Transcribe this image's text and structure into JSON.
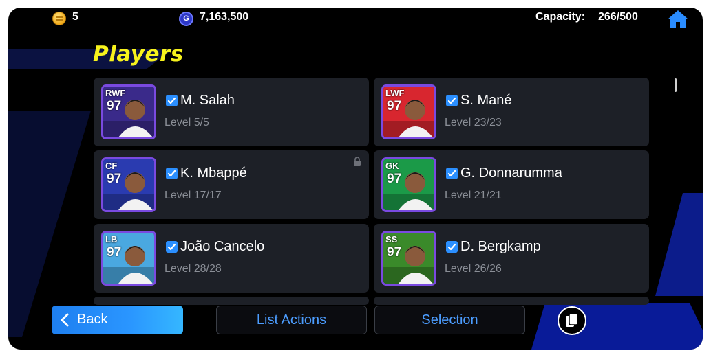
{
  "topbar": {
    "coins": "5",
    "gp_icon_letter": "G",
    "gp": "7,163,500",
    "capacity_label": "Capacity:",
    "capacity_value": "266/500"
  },
  "title": "Players",
  "players": [
    {
      "position": "RWF",
      "rating": "97",
      "name": "M. Salah",
      "level": "Level 5/5",
      "card_color": "#3a2a8a",
      "locked": false
    },
    {
      "position": "LWF",
      "rating": "97",
      "name": "S. Mané",
      "level": "Level 23/23",
      "card_color": "#d8262f",
      "locked": false
    },
    {
      "position": "CF",
      "rating": "97",
      "name": "K. Mbappé",
      "level": "Level 17/17",
      "card_color": "#2a3bb0",
      "locked": true
    },
    {
      "position": "GK",
      "rating": "97",
      "name": "G. Donnarumma",
      "level": "Level 21/21",
      "card_color": "#1b9a48",
      "locked": false
    },
    {
      "position": "LB",
      "rating": "97",
      "name": "João Cancelo",
      "level": "Level 28/28",
      "card_color": "#4aa8e0",
      "locked": false
    },
    {
      "position": "SS",
      "rating": "97",
      "name": "D. Bergkamp",
      "level": "Level 26/26",
      "card_color": "#3a8a2a",
      "locked": false
    }
  ],
  "buttons": {
    "back": "Back",
    "list_actions": "List Actions",
    "selection": "Selection"
  },
  "colors": {
    "accent_title": "#f7f21c",
    "primary_blue": "#2a96ff",
    "card_bg": "#1d2027"
  }
}
